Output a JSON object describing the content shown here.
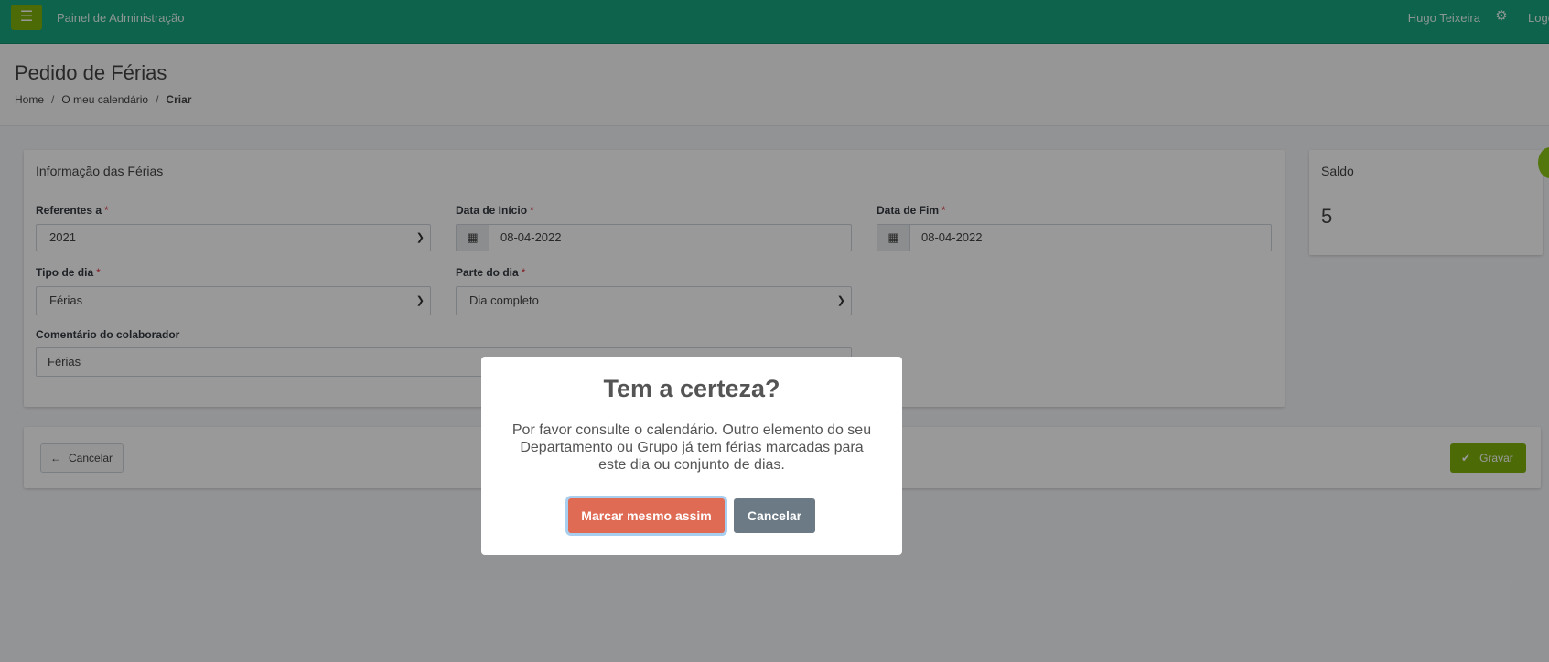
{
  "navbar": {
    "menu_icon": "hamburger-icon",
    "brand": "Painel de Administração",
    "user": "Hugo Teixeira",
    "settings_icon": "gear-icon",
    "logout": "Logout"
  },
  "header": {
    "title": "Pedido de Férias",
    "breadcrumb": [
      "Home",
      "O meu calendário",
      "Criar"
    ]
  },
  "form_card": {
    "title": "Informação das Férias",
    "referentes_label": "Referentes a",
    "referentes_value": "2021",
    "data_inicio_label": "Data de Início",
    "data_inicio_value": "08-04-2022",
    "data_fim_label": "Data de Fim",
    "data_fim_value": "08-04-2022",
    "tipo_dia_label": "Tipo de dia",
    "tipo_dia_value": "Férias",
    "parte_dia_label": "Parte do dia",
    "parte_dia_value": "Dia completo",
    "comentario_label": "Comentário do colaborador",
    "comentario_value": "Férias",
    "required_mark": "*"
  },
  "actions": {
    "cancel_label": "Cancelar",
    "save_label": "Gravar"
  },
  "saldo": {
    "title": "Saldo",
    "value": "5"
  },
  "modal": {
    "title": "Tem a certeza?",
    "text": "Por favor consulte o calendário. Outro elemento do seu Departamento ou Grupo já tem férias marcadas para este dia ou conjunto de dias.",
    "confirm_label": "Marcar mesmo assim",
    "cancel_label": "Cancelar"
  },
  "colors": {
    "navbar": "#17a57e",
    "accent_green": "#7fb30c",
    "confirm": "#e06b55",
    "modal_cancel": "#6c7a85",
    "required": "#dc3545"
  }
}
